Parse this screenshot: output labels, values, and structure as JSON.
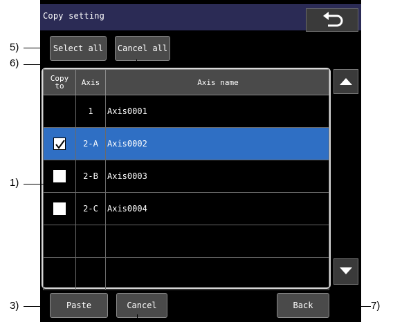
{
  "title": "Copy setting",
  "buttons": {
    "select_all": "Select all",
    "cancel_all": "Cancel all",
    "paste": "Paste",
    "cancel": "Cancel",
    "back": "Back"
  },
  "table": {
    "headers": [
      "Copy to",
      "Axis",
      "Axis name"
    ],
    "header_copy_line1": "Copy",
    "header_copy_line2": "to",
    "rows": [
      {
        "checkbox": "none",
        "axis": "1",
        "name": "Axis0001",
        "selected": false
      },
      {
        "checkbox": "checked",
        "axis": "2-A",
        "name": "Axis0002",
        "selected": true
      },
      {
        "checkbox": "unchecked",
        "axis": "2-B",
        "name": "Axis0003",
        "selected": false
      },
      {
        "checkbox": "unchecked",
        "axis": "2-C",
        "name": "Axis0004",
        "selected": false
      },
      {
        "checkbox": "none",
        "axis": "",
        "name": "",
        "selected": false
      },
      {
        "checkbox": "none",
        "axis": "",
        "name": "",
        "selected": false
      }
    ]
  },
  "callouts": {
    "c1": "1)",
    "c3": "3)",
    "c5": "5)",
    "c6": "6)",
    "c7": "7)"
  },
  "colors": {
    "title_bar": "#2b2b55",
    "selected_row": "#2f6fc4",
    "button": "#4a4a4a"
  },
  "icons": [
    "return-arrow-icon",
    "scroll-up-icon",
    "scroll-down-icon",
    "checkmark-icon"
  ]
}
